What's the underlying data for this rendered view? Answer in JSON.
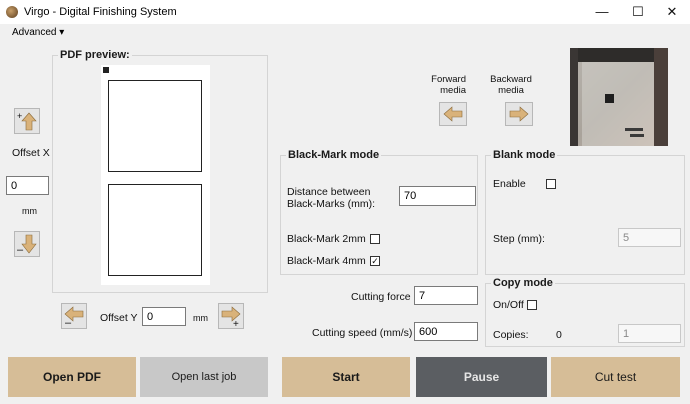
{
  "window": {
    "title": "Virgo - Digital Finishing System",
    "minimize": "—",
    "maximize": "☐",
    "close": "✕"
  },
  "menu": {
    "advanced": "Advanced ▾"
  },
  "pdf_preview": {
    "title": "PDF preview:"
  },
  "offset_x": {
    "label": "Offset X",
    "value": "0",
    "unit": "mm"
  },
  "offset_y": {
    "label": "Offset Y",
    "value": "0",
    "unit": "mm"
  },
  "media": {
    "forward": "Forward\nmedia",
    "backward": "Backward\nmedia"
  },
  "black_mark": {
    "title": "Black-Mark mode",
    "distance_label": "Distance between\nBlack-Marks (mm):",
    "distance_value": "70",
    "mark2_label": "Black-Mark 2mm",
    "mark2_checked": "",
    "mark4_label": "Black-Mark 4mm",
    "mark4_checked": "✓"
  },
  "blank_mode": {
    "title": "Blank mode",
    "enable_label": "Enable",
    "enable_checked": "",
    "step_label": "Step (mm):",
    "step_value": "5"
  },
  "cutting": {
    "force_label": "Cutting force",
    "force_value": "7",
    "speed_label": "Cutting speed (mm/s)",
    "speed_value": "600"
  },
  "copy_mode": {
    "title": "Copy mode",
    "onoff_label": "On/Off",
    "onoff_checked": "",
    "copies_label": "Copies:",
    "copies_count": "0",
    "copies_value": "1"
  },
  "buttons": {
    "open_pdf": "Open PDF",
    "open_last_job": "Open last job",
    "start": "Start",
    "pause": "Pause",
    "cut_test": "Cut test"
  },
  "colors": {
    "tan": "#d6bd97",
    "light_gray": "#c8c8c8",
    "dark_gray": "#5b5e62",
    "arrow": "#d9b27a"
  }
}
